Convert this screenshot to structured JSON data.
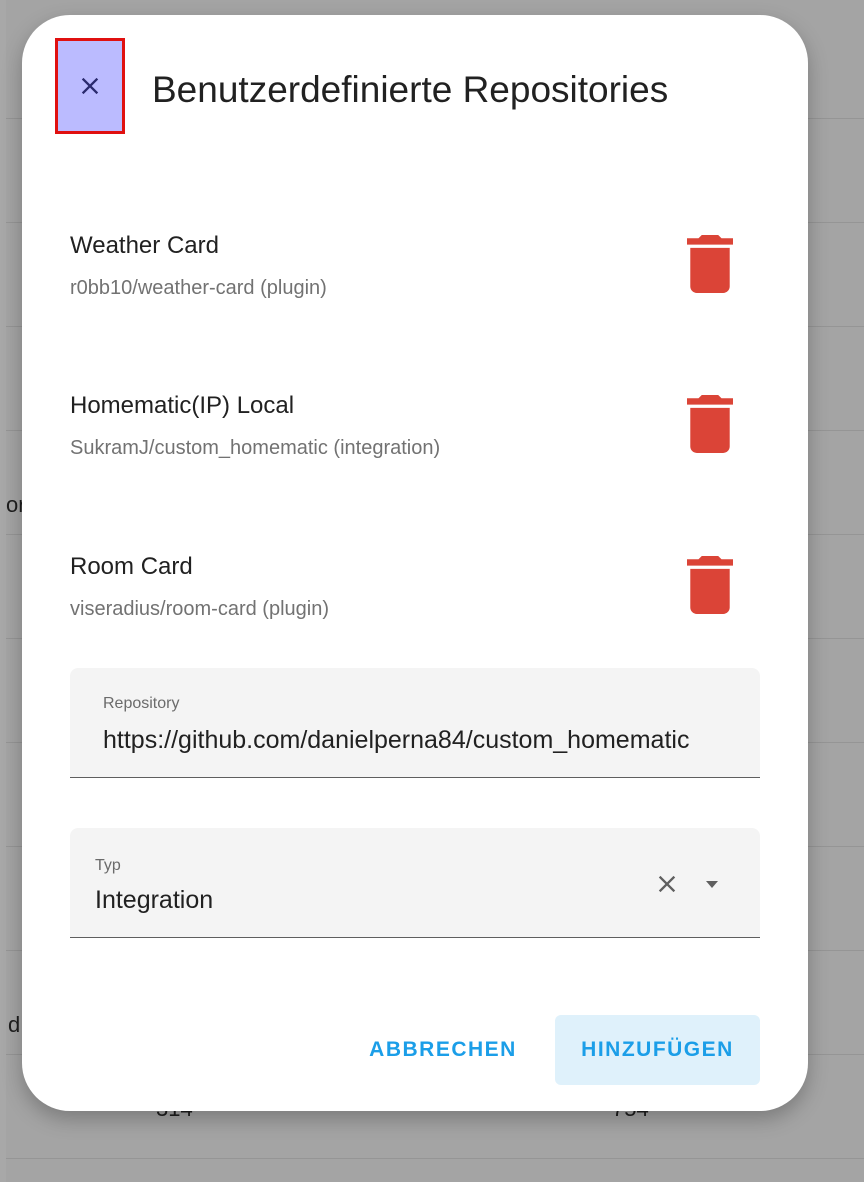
{
  "background": {
    "fragments": [
      "or",
      "d",
      "314",
      "754"
    ]
  },
  "dialog": {
    "title": "Benutzerdefinierte Repositories",
    "close_icon": "close-icon",
    "repositories": [
      {
        "name": "Weather Card",
        "path": "r0bb10/weather-card (plugin)",
        "icon": "trash-icon"
      },
      {
        "name": "Homematic(IP) Local",
        "path": "SukramJ/custom_homematic (integration)",
        "icon": "trash-icon"
      },
      {
        "name": "Room Card",
        "path": "viseradius/room-card (plugin)",
        "icon": "trash-icon"
      }
    ],
    "repository_field": {
      "label": "Repository",
      "value": "https://github.com/danielperna84/custom_homematic"
    },
    "type_field": {
      "label": "Typ",
      "value": "Integration",
      "clear_icon": "clear-icon",
      "dropdown_icon": "arrow-drop-down-icon"
    },
    "buttons": {
      "cancel": "ABBRECHEN",
      "add": "HINZUFÜGEN"
    }
  },
  "colors": {
    "accent": "#1b9ee8",
    "delete": "#db4437",
    "close_highlight": "#bbbbff",
    "close_border": "#e01010"
  }
}
